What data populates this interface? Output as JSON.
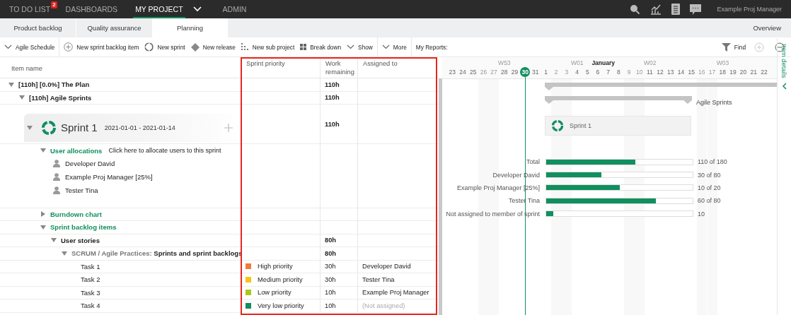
{
  "nav": {
    "items": [
      {
        "label": "TO DO LIST",
        "selected": false,
        "badge": "2"
      },
      {
        "label": "DASHBOARDS",
        "selected": false
      },
      {
        "label": "MY PROJECT",
        "selected": true,
        "menu": true
      },
      {
        "label": "ADMIN",
        "selected": false
      }
    ],
    "user": "Example Proj Manager"
  },
  "subtabs": [
    {
      "label": "Product backlog",
      "selected": false
    },
    {
      "label": "Quality assurance",
      "selected": false
    },
    {
      "label": "Planning",
      "selected": true
    }
  ],
  "overview": "Overview",
  "toolbar": [
    {
      "label": "Agile Schedule",
      "kind": "dropdown"
    },
    {
      "label": "New sprint backlog item",
      "kind": "add"
    },
    {
      "label": "New sprint",
      "kind": "sprint"
    },
    {
      "label": "New release",
      "kind": "release"
    },
    {
      "label": "New sub project",
      "kind": "subproject"
    },
    {
      "label": "Break down",
      "kind": "breakdown"
    },
    {
      "label": "Show",
      "kind": "dropdown"
    },
    {
      "label": "More",
      "kind": "dropdown"
    }
  ],
  "reports_label": "My Reports:",
  "find": "Find",
  "columns": [
    "Item name",
    "Sprint priority",
    "Work remaining",
    "Assigned to"
  ],
  "timeline": {
    "days": [
      {
        "label": "23",
        "weekend": false,
        "today": false
      },
      {
        "label": "24",
        "weekend": false,
        "today": false
      },
      {
        "label": "25",
        "weekend": false,
        "today": false
      },
      {
        "label": "26",
        "weekend": true,
        "today": false
      },
      {
        "label": "27",
        "weekend": true,
        "today": false
      },
      {
        "label": "28",
        "weekend": false,
        "today": false,
        "week": "W53"
      },
      {
        "label": "29",
        "weekend": false,
        "today": false
      },
      {
        "label": "30",
        "weekend": false,
        "today": true
      },
      {
        "label": "31",
        "weekend": false,
        "today": false
      },
      {
        "label": "1",
        "weekend": false,
        "today": false
      },
      {
        "label": "2",
        "weekend": true,
        "today": false
      },
      {
        "label": "3",
        "weekend": true,
        "today": false
      },
      {
        "label": "4",
        "weekend": false,
        "today": false,
        "week": "W01",
        "month": "January"
      },
      {
        "label": "5",
        "weekend": false,
        "today": false
      },
      {
        "label": "6",
        "weekend": false,
        "today": false
      },
      {
        "label": "7",
        "weekend": false,
        "today": false
      },
      {
        "label": "8",
        "weekend": false,
        "today": false
      },
      {
        "label": "9",
        "weekend": true,
        "today": false
      },
      {
        "label": "10",
        "weekend": true,
        "today": false
      },
      {
        "label": "11",
        "weekend": false,
        "today": false,
        "week": "W02"
      },
      {
        "label": "12",
        "weekend": false,
        "today": false
      },
      {
        "label": "13",
        "weekend": false,
        "today": false
      },
      {
        "label": "14",
        "weekend": false,
        "today": false
      },
      {
        "label": "15",
        "weekend": false,
        "today": false
      },
      {
        "label": "16",
        "weekend": true,
        "today": false
      },
      {
        "label": "17",
        "weekend": true,
        "today": false
      },
      {
        "label": "18",
        "weekend": false,
        "today": false,
        "week": "W03"
      },
      {
        "label": "19",
        "weekend": false,
        "today": false
      },
      {
        "label": "20",
        "weekend": false,
        "today": false
      },
      {
        "label": "21",
        "weekend": false,
        "today": false
      },
      {
        "label": "22",
        "weekend": false,
        "today": false
      }
    ]
  },
  "rows": [
    {
      "kind": "summary",
      "name": "[110h] [0.0%] The Plan",
      "work": "110h",
      "expanded": true,
      "children": [
        {
          "kind": "summary",
          "name": "[110h] Agile Sprints",
          "work": "110h",
          "expanded": true,
          "children": [
            {
              "kind": "sprint",
              "name": "Sprint 1",
              "dates": "2021-01-01 - 2021-01-14",
              "work": "110h",
              "expanded": true,
              "children": [
                {
                  "kind": "allocations",
                  "name": "User allocations",
                  "hint": "Click here to allocate users to this sprint",
                  "expanded": true,
                  "children": [
                    {
                      "kind": "user",
                      "name": "Developer David"
                    },
                    {
                      "kind": "user",
                      "name": "Example Proj Manager [25%]"
                    },
                    {
                      "kind": "user",
                      "name": "Tester Tina"
                    }
                  ]
                },
                {
                  "kind": "section",
                  "name": "Burndown chart",
                  "expanded": false
                },
                {
                  "kind": "section",
                  "name": "Sprint backlog items",
                  "expanded": true,
                  "children": [
                    {
                      "kind": "summary",
                      "name": "User stories",
                      "work": "80h",
                      "expanded": true,
                      "children": [
                        {
                          "kind": "story",
                          "prefix": "SCRUM / Agile Practices:",
                          "name": "Sprints and sprint backlogs",
                          "work": "80h",
                          "expanded": true,
                          "children": [
                            {
                              "kind": "task",
                              "name": "Task 1",
                              "priority": "High priority",
                              "color": "#f07b3a",
                              "work": "30h",
                              "assigned": "Developer David",
                              "unassigned": false
                            },
                            {
                              "kind": "task",
                              "name": "Task 2",
                              "priority": "Medium priority",
                              "color": "#f5c518",
                              "work": "30h",
                              "assigned": "Tester Tina",
                              "unassigned": false
                            },
                            {
                              "kind": "task",
                              "name": "Task 3",
                              "priority": "Low priority",
                              "color": "#a8c81e",
                              "work": "10h",
                              "assigned": "Example Proj Manager",
                              "unassigned": false
                            },
                            {
                              "kind": "task",
                              "name": "Task 4",
                              "priority": "Very low priority",
                              "color": "#128f5f",
                              "work": "10h",
                              "assigned": "(Not assigned)",
                              "unassigned": true
                            }
                          ]
                        }
                      ]
                    }
                  ]
                }
              ]
            }
          ]
        }
      ]
    }
  ],
  "gantt": {
    "sprints_label": "Agile Sprints",
    "sprint_label": "Sprint 1",
    "allocations": [
      {
        "label": "Total",
        "level": 0.61,
        "reading": "110 of 180"
      },
      {
        "label": "Developer David",
        "level": 0.375,
        "reading": "30 of 80"
      },
      {
        "label": "Example Proj Manager [25%]",
        "level": 0.5,
        "reading": "10 of 20"
      },
      {
        "label": "Tester Tina",
        "level": 0.75,
        "reading": "60 of 80"
      },
      {
        "label": "Not assigned to member of sprint",
        "level": 0.05,
        "reading": "10"
      }
    ]
  },
  "side_panel": "Item details"
}
